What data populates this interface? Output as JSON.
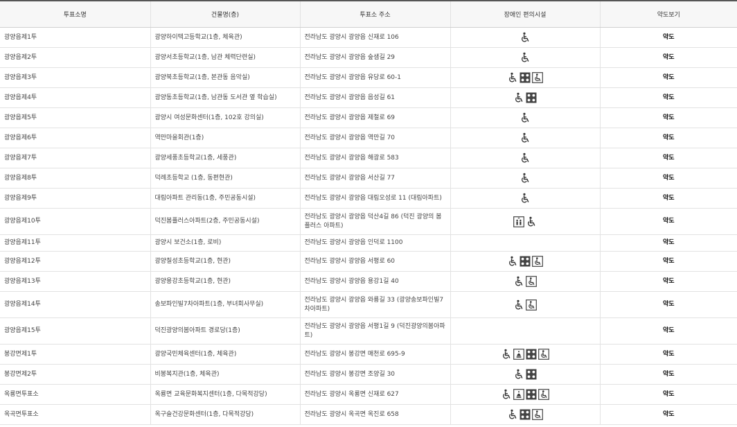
{
  "table": {
    "headers": [
      "투표소명",
      "건물명(층)",
      "투표소 주소",
      "장애인 편의시설",
      "약도보기"
    ],
    "rows": [
      {
        "name": "광양읍제1투",
        "building": "광양하이텍고등학교(1층, 체육관)",
        "address": "전라남도 광양시 광양읍 신재로 106",
        "facilities": [
          "wheelchair-icon"
        ],
        "map": "약도"
      },
      {
        "name": "광양읍제2투",
        "building": "광양서초등학교(1층, 남관 체력단련실)",
        "address": "전라남도 광양시 광양읍 숲샘길 29",
        "facilities": [
          "wheelchair-icon"
        ],
        "map": "약도"
      },
      {
        "name": "광양읍제3투",
        "building": "광양북초등학교(1층, 본관동 음악실)",
        "address": "전라남도 광양시 광양읍 유당로 60-1",
        "facilities": [
          "wheelchair-icon",
          "braille-icon",
          "wheelchair-box-icon"
        ],
        "map": "약도"
      },
      {
        "name": "광양읍제4투",
        "building": "광양동초등학교(1층, 남관동 도서관 옆 학습실)",
        "address": "전라남도 광양시 광양읍 읍성길 61",
        "facilities": [
          "wheelchair-icon",
          "braille-icon"
        ],
        "map": "약도"
      },
      {
        "name": "광양읍제5투",
        "building": "광양시 여성문화센터(1층, 102호 강의실)",
        "address": "전라남도 광양시 광양읍 제철로 69",
        "facilities": [
          "wheelchair-icon"
        ],
        "map": "약도"
      },
      {
        "name": "광양읍제6투",
        "building": "역만마을회관(1층)",
        "address": "전라남도 광양시 광양읍 역만길 70",
        "facilities": [
          "wheelchair-icon"
        ],
        "map": "약도"
      },
      {
        "name": "광양읍제7투",
        "building": "광양세풍초등학교(1층, 세풍관)",
        "address": "전라남도 광양시 광양읍 해광로 583",
        "facilities": [
          "wheelchair-icon"
        ],
        "map": "약도"
      },
      {
        "name": "광양읍제8투",
        "building": "덕례초등학교 (1층, 동편현관)",
        "address": "전라남도 광양시 광양읍 서산길 77",
        "facilities": [
          "wheelchair-icon"
        ],
        "map": "약도"
      },
      {
        "name": "광양읍제9투",
        "building": "대림아파트 관리동(1층, 주민공동시설)",
        "address": "전라남도 광양시 광양읍 대림오성로 11 (대림아파트)",
        "facilities": [
          "wheelchair-icon"
        ],
        "map": "약도"
      },
      {
        "name": "광양읍제10투",
        "building": "덕진봄플러스아파트(2층, 주민공동시설)",
        "address": "전라남도 광양시 광양읍 덕산4길 86 (덕진 광양의 봄 플러스 아파트)",
        "facilities": [
          "elevator-icon",
          "wheelchair-icon"
        ],
        "map": "약도"
      },
      {
        "name": "광양읍제11투",
        "building": "광양시 보건소(1층, 로비)",
        "address": "전라남도 광양시 광양읍 인덕로 1100",
        "facilities": [],
        "map": "약도"
      },
      {
        "name": "광양읍제12투",
        "building": "광양칠성초등학교(1층, 현관)",
        "address": "전라남도 광양시 광양읍 서평로 60",
        "facilities": [
          "wheelchair-icon",
          "braille-icon",
          "wheelchair-box-icon"
        ],
        "map": "약도"
      },
      {
        "name": "광양읍제13투",
        "building": "광양용강초등학교(1층, 현관)",
        "address": "전라남도 광양시 광양읍 용강1길 40",
        "facilities": [
          "wheelchair-icon",
          "wheelchair-box-icon"
        ],
        "map": "약도"
      },
      {
        "name": "광양읍제14투",
        "building": "송보파인빌7차아파트(1층, 부녀회사무실)",
        "address": "전라남도 광양시 광양읍 와룡길 33 (광양송보파인빌7차아파트)",
        "facilities": [
          "wheelchair-icon",
          "wheelchair-box-icon"
        ],
        "map": "약도"
      },
      {
        "name": "광양읍제15투",
        "building": "덕진광양의봄아파트 경로당(1층)",
        "address": "전라남도 광양시 광양읍 서평1길 9 (덕진광양의봄아파트)",
        "facilities": [],
        "map": "약도"
      },
      {
        "name": "봉강면제1투",
        "building": "광양국민체육센터(1층, 체육관)",
        "address": "전라남도 광양시 봉강면 매천로 695-9",
        "facilities": [
          "wheelchair-icon",
          "hearing-icon",
          "braille-icon",
          "wheelchair-box-icon"
        ],
        "map": "약도"
      },
      {
        "name": "봉강면제2투",
        "building": "비봉복지관(1층, 체육관)",
        "address": "전라남도 광양시 봉강면 조양길 30",
        "facilities": [
          "wheelchair-icon",
          "braille-icon"
        ],
        "map": "약도"
      },
      {
        "name": "옥룡면투표소",
        "building": "옥룡면 교육문화복지센터(1층, 다목적강당)",
        "address": "전라남도 광양시 옥룡면 신재로 627",
        "facilities": [
          "wheelchair-icon",
          "hearing-icon",
          "braille-icon",
          "wheelchair-box-icon"
        ],
        "map": "약도"
      },
      {
        "name": "옥곡면투표소",
        "building": "옥구슬건강문화센터(1층, 다목적강당)",
        "address": "전라남도 광양시 옥곡면 옥진로 658",
        "facilities": [
          "wheelchair-icon",
          "braille-icon",
          "wheelchair-box-icon"
        ],
        "map": "약도"
      }
    ]
  }
}
